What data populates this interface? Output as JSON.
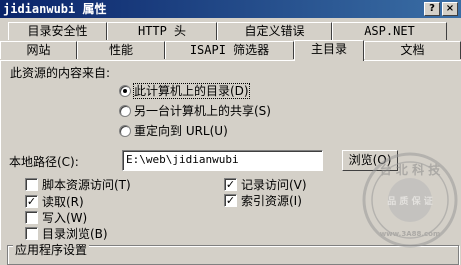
{
  "window": {
    "title": "jidianwubi 属性",
    "help_button": "?",
    "close_button": "×"
  },
  "tabs_row1": [
    {
      "label": "目录安全性"
    },
    {
      "label": "HTTP 头"
    },
    {
      "label": "自定义错误"
    },
    {
      "label": "ASP.NET"
    }
  ],
  "tabs_row2": [
    {
      "label": "网站"
    },
    {
      "label": "性能"
    },
    {
      "label": "ISAPI 筛选器"
    },
    {
      "label": "主目录",
      "active": true
    },
    {
      "label": "文档"
    }
  ],
  "content_source": {
    "heading": "此资源的内容来自:",
    "options": [
      {
        "label": "此计算机上的目录(D)",
        "selected": true
      },
      {
        "label": "另一台计算机上的共享(S)",
        "selected": false
      },
      {
        "label": "重定向到 URL(U)",
        "selected": false
      }
    ]
  },
  "local_path": {
    "label": "本地路径(C):",
    "value": "E:\\web\\jidianwubi",
    "browse_label": "浏览(O)"
  },
  "permissions_left": [
    {
      "label": "脚本资源访问(T)",
      "checked": false
    },
    {
      "label": "读取(R)",
      "checked": true
    },
    {
      "label": "写入(W)",
      "checked": false
    },
    {
      "label": "目录浏览(B)",
      "checked": false
    }
  ],
  "permissions_right": [
    {
      "label": "记录访问(V)",
      "checked": true
    },
    {
      "label": "索引资源(I)",
      "checked": true
    }
  ],
  "app_settings": {
    "heading": "应用程序设置"
  },
  "watermark": {
    "text_top": "台 北 科 技",
    "text_mid": "品 质 保 证",
    "text_bottom": "www.3A88.com"
  }
}
